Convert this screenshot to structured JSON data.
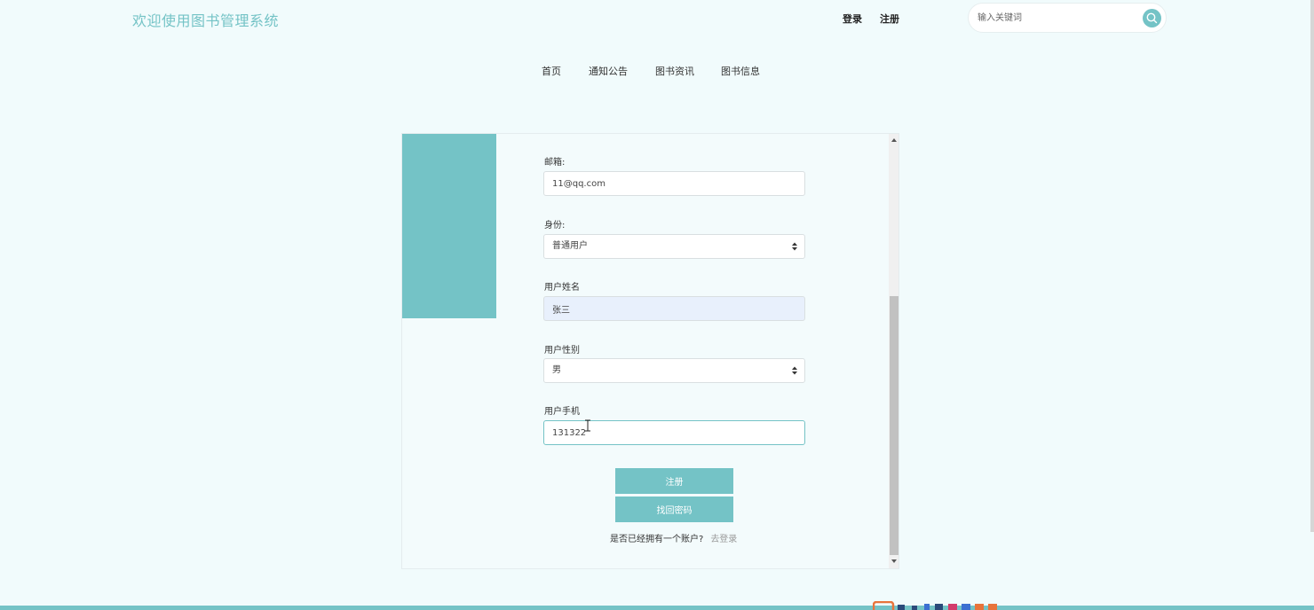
{
  "header": {
    "site_title": "欢迎使用图书管理系统",
    "login_label": "登录",
    "register_label": "注册",
    "search_placeholder": "输入关键词",
    "search_icon": "search-icon"
  },
  "nav": {
    "items": [
      {
        "label": "首页"
      },
      {
        "label": "通知公告"
      },
      {
        "label": "图书资讯"
      },
      {
        "label": "图书信息"
      }
    ]
  },
  "form": {
    "email": {
      "label": "邮箱:",
      "value": "11@qq.com"
    },
    "role": {
      "label": "身份:",
      "value": "普通用户"
    },
    "name": {
      "label": "用户姓名",
      "value": "张三"
    },
    "gender": {
      "label": "用户性别",
      "value": "男"
    },
    "phone": {
      "label": "用户手机",
      "value": "131322"
    },
    "register_button": "注册",
    "recover_button": "找回密码",
    "has_account_text": "是否已经拥有一个账户?",
    "go_login_link": "去登录"
  },
  "colors": {
    "accent": "#74c3c6",
    "background": "#f1fbfc"
  }
}
